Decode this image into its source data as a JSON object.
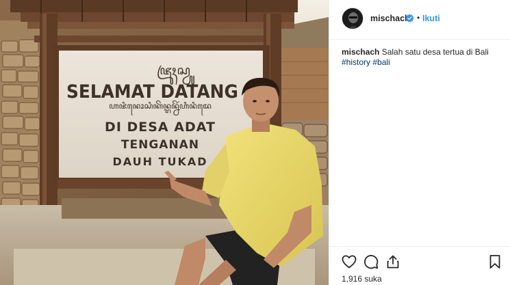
{
  "photo": {
    "sign": {
      "script_top": "ꦗꦿꦸꦃꦱ꧀ꦮꦸ",
      "line1": "SELAMAT DATANG",
      "script_mid": "ꦲꦗꦶꦤꦺꦴꦱꦶꦏꦼꦤ꧀ꦫꦤ꧀ꦤꦼꦂꦲꦶꦤꦶꦢꦺ",
      "line2": "DI DESA ADAT",
      "line3": "TENGANAN",
      "line4": "DAUH TUKAD"
    }
  },
  "post": {
    "author": {
      "username": "mischach",
      "avatar_icon": "profile-avatar",
      "verified_icon": "verified-badge-icon",
      "separator": "•",
      "follow_label": "Ikuti"
    },
    "caption": {
      "username": "mischach",
      "text": "Salah satu desa tertua di Bali",
      "hashtags": [
        "#history",
        "#bali"
      ]
    },
    "actions": {
      "like_icon": "heart-icon",
      "comment_icon": "comment-icon",
      "share_icon": "share-icon",
      "save_icon": "bookmark-icon"
    },
    "likes_text": "1,916 suka"
  },
  "colors": {
    "link_blue": "#3897f0",
    "hashtag": "#003569",
    "text": "#262626",
    "border": "#efefef"
  }
}
